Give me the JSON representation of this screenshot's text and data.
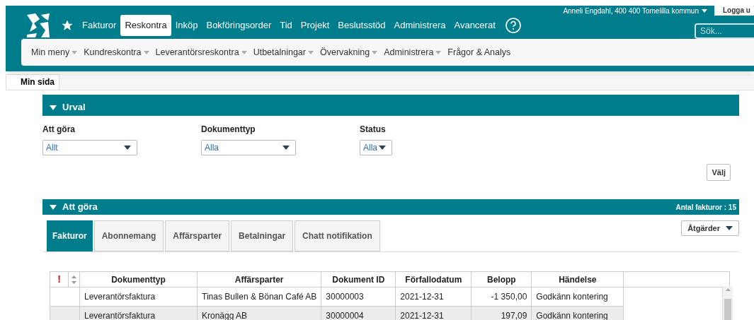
{
  "header": {
    "user": "Anneli Engdahl, 400 400 Tomelilla kommun",
    "logout": "Logga u",
    "search": {
      "placeholder": "Sök..."
    },
    "main_menu": [
      {
        "label": "Fakturor",
        "selected": false
      },
      {
        "label": "Reskontra",
        "selected": true
      },
      {
        "label": "Inköp",
        "selected": false
      },
      {
        "label": "Bokföringsorder",
        "selected": false
      },
      {
        "label": "Tid",
        "selected": false
      },
      {
        "label": "Projekt",
        "selected": false
      },
      {
        "label": "Beslutsstöd",
        "selected": false
      },
      {
        "label": "Administrera",
        "selected": false
      },
      {
        "label": "Avancerat",
        "selected": false
      }
    ],
    "sub_menu": [
      {
        "label": "Min meny",
        "dropdown": true
      },
      {
        "label": "Kundreskontra",
        "dropdown": true
      },
      {
        "label": "Leverantörsreskontra",
        "dropdown": true
      },
      {
        "label": "Utbetalningar",
        "dropdown": true
      },
      {
        "label": "Övervakning",
        "dropdown": true
      },
      {
        "label": "Administrera",
        "dropdown": true
      },
      {
        "label": "Frågor & Analys",
        "dropdown": false
      }
    ]
  },
  "page_tab": "Min sida",
  "urval": {
    "title": "Urval",
    "filters": [
      {
        "label": "Att göra",
        "value": "Allt",
        "wide": true
      },
      {
        "label": "Dokumenttyp",
        "value": "Alla",
        "wide": true
      },
      {
        "label": "Status",
        "value": "Alla",
        "wide": false
      }
    ],
    "button": "Välj"
  },
  "att_gora": {
    "title": "Att göra",
    "count_label": "Antal fakturor : 15",
    "actions": "Åtgärder",
    "tabs": [
      {
        "label": "Fakturor",
        "selected": true
      },
      {
        "label": "Abonnemang",
        "selected": false
      },
      {
        "label": "Affärsparter",
        "selected": false
      },
      {
        "label": "Betalningar",
        "selected": false
      },
      {
        "label": "Chatt notifikation",
        "selected": false
      }
    ],
    "table": {
      "flag_column": "!",
      "columns": [
        "Dokumenttyp",
        "Affärsparter",
        "Dokument ID",
        "Förfallodatum",
        "Belopp",
        "Händelse"
      ],
      "rows": [
        [
          "Leverantörsfaktura",
          "Tinas Bullen & Bönan Café AB",
          "30000003",
          "2021-12-31",
          "-1 350,00",
          "Godkänn kontering"
        ],
        [
          "Leverantörsfaktura",
          "Kronägg AB",
          "30000004",
          "2021-12-31",
          "197,09",
          "Godkänn kontering"
        ]
      ]
    }
  }
}
